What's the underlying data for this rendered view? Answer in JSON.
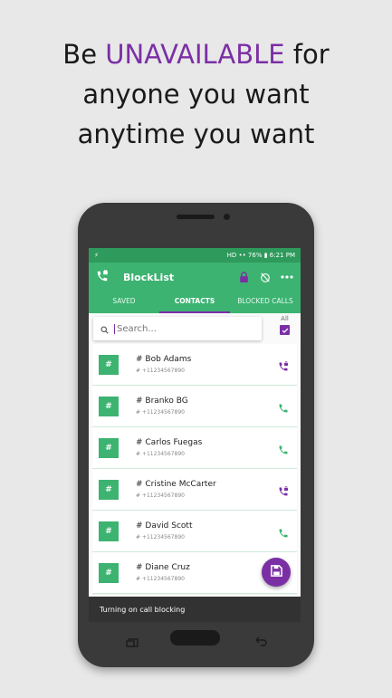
{
  "headline": {
    "prefix": "Be ",
    "accent": "UNAVAILABLE",
    "suffix": " for",
    "line2": "anyone you want",
    "line3": "anytime you want"
  },
  "statusbar": {
    "left": "⚡",
    "right": "HD •• 76% ▮ 6:21 PM"
  },
  "appbar": {
    "title": "BlockList"
  },
  "tabs": [
    {
      "label": "SAVED"
    },
    {
      "label": "CONTACTS"
    },
    {
      "label": "BLOCKED CALLS"
    }
  ],
  "search": {
    "placeholder": "Search..."
  },
  "select_all": {
    "label": "All",
    "checked": true
  },
  "contacts": [
    {
      "initial": "#",
      "name": "# Bob Adams",
      "number": "# +11234567890",
      "blocked": true
    },
    {
      "initial": "#",
      "name": "# Branko BG",
      "number": "# +11234567890",
      "blocked": false
    },
    {
      "initial": "#",
      "name": "# Carlos Fuegas",
      "number": "# +11234567890",
      "blocked": false
    },
    {
      "initial": "#",
      "name": "# Cristine McCarter",
      "number": "# +11234567890",
      "blocked": true
    },
    {
      "initial": "#",
      "name": "# David Scott",
      "number": "# +11234567890",
      "blocked": false
    },
    {
      "initial": "#",
      "name": "# Diane Cruz",
      "number": "# +11234567890",
      "blocked": false
    }
  ],
  "snackbar": {
    "text": "Turning on call blocking"
  },
  "colors": {
    "green": "#3cb371",
    "purple": "#7b2fa5"
  }
}
